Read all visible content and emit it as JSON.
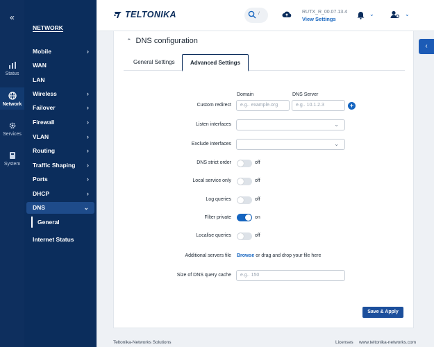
{
  "rail": {
    "collapse_glyph": "«",
    "items": [
      {
        "label": "Status",
        "icon": "status-icon"
      },
      {
        "label": "Network",
        "icon": "globe-icon"
      },
      {
        "label": "Services",
        "icon": "gear-icon"
      },
      {
        "label": "System",
        "icon": "system-icon"
      }
    ]
  },
  "nav": {
    "title": "NETWORK",
    "items": [
      {
        "label": "Mobile",
        "chevron": "›"
      },
      {
        "label": "WAN",
        "chevron": ""
      },
      {
        "label": "LAN",
        "chevron": ""
      },
      {
        "label": "Wireless",
        "chevron": "›"
      },
      {
        "label": "Failover",
        "chevron": "›"
      },
      {
        "label": "Firewall",
        "chevron": "›"
      },
      {
        "label": "VLAN",
        "chevron": "›"
      },
      {
        "label": "Routing",
        "chevron": "›"
      },
      {
        "label": "Traffic Shaping",
        "chevron": "›"
      },
      {
        "label": "Ports",
        "chevron": "›"
      },
      {
        "label": "DHCP",
        "chevron": "›"
      },
      {
        "label": "DNS",
        "chevron": "⌄"
      }
    ],
    "sub_item": "General",
    "extra_item": "Internet Status"
  },
  "header": {
    "logo_text": "TELTONIKA",
    "search_kbd": "/",
    "firmware": "RUTX_R_00.07.13.4",
    "firmware_link": "View Settings"
  },
  "page": {
    "section_title": "DNS configuration",
    "tabs": [
      "General Settings",
      "Advanced Settings"
    ],
    "columns": {
      "domain": "Domain",
      "dns_server": "DNS Server"
    },
    "custom_redirect": {
      "label": "Custom redirect",
      "domain_placeholder": "e.g.. example.org",
      "server_placeholder": "e.g.. 10.1.2.3"
    },
    "listen_interfaces": {
      "label": "Listen interfaces"
    },
    "exclude_interfaces": {
      "label": "Exclude interfaces"
    },
    "toggles": [
      {
        "label": "DNS strict order",
        "state": "off"
      },
      {
        "label": "Local service only",
        "state": "off"
      },
      {
        "label": "Log queries",
        "state": "off"
      },
      {
        "label": "Filter private",
        "state": "on"
      },
      {
        "label": "Localise queries",
        "state": "off"
      }
    ],
    "additional_servers": {
      "label": "Additional servers file",
      "browse": "Browse",
      "hint": " or drag and drop your file here"
    },
    "cache_size": {
      "label": "Size of DNS query cache",
      "placeholder": "e.g.. 150"
    },
    "save_label": "Save & Apply"
  },
  "footer": {
    "left": "Teltonika-Networks Solutions",
    "licenses": "Licenses",
    "url": "www.teltonika-networks.com"
  },
  "colors": {
    "nav_bg": "#0b2d5c",
    "accent": "#1565c0",
    "button": "#1c4f9c"
  }
}
